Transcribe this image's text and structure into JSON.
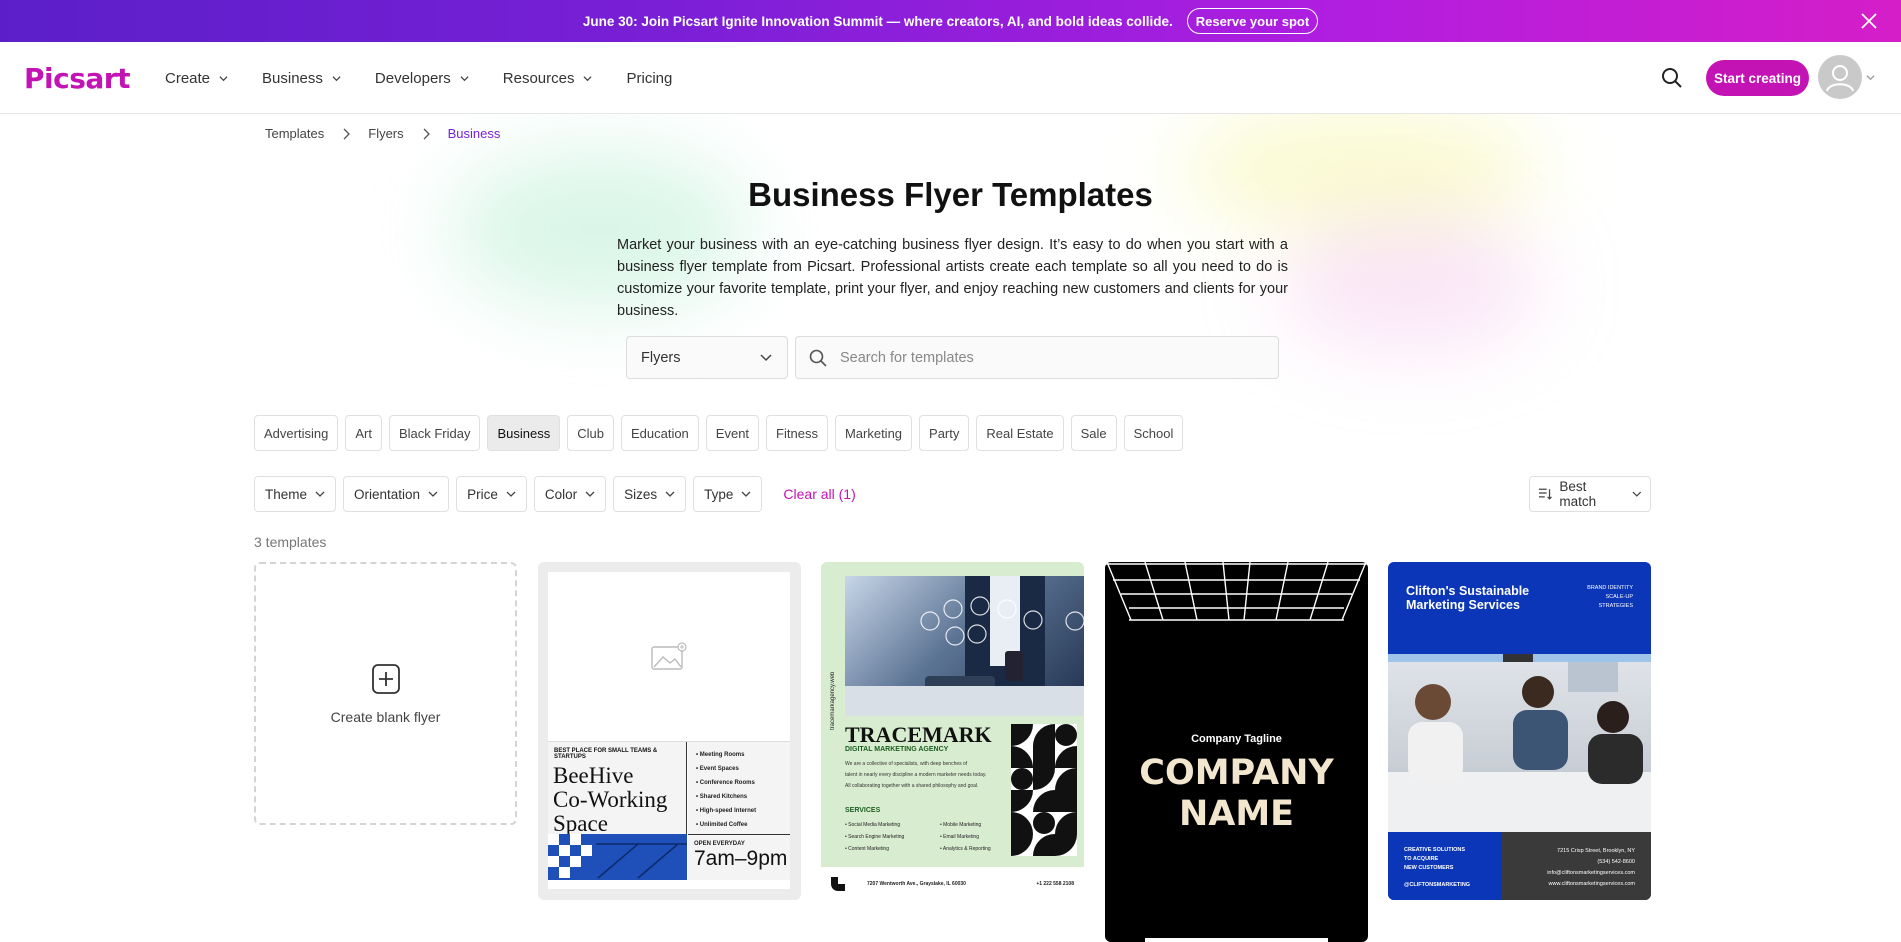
{
  "banner": {
    "text": "June 30: Join Picsart Ignite Innovation Summit — where creators, AI, and bold ideas collide.",
    "button": "Reserve your spot"
  },
  "header": {
    "logo": "Picsart",
    "nav": [
      {
        "label": "Create",
        "has_menu": true
      },
      {
        "label": "Business",
        "has_menu": true
      },
      {
        "label": "Developers",
        "has_menu": true
      },
      {
        "label": "Resources",
        "has_menu": true
      },
      {
        "label": "Pricing",
        "has_menu": false
      }
    ],
    "cta": "Start creating"
  },
  "breadcrumb": [
    "Templates",
    "Flyers",
    "Business"
  ],
  "page": {
    "title": "Business Flyer Templates",
    "intro": "Market your business with an eye-catching business flyer design. It’s easy to do when you start with a business flyer template from Picsart. Professional artists create each template so all you need to do is customize your favorite template, print your flyer, and enjoy reaching new customers and clients for your business."
  },
  "search": {
    "type_value": "Flyers",
    "placeholder": "Search for templates"
  },
  "chips": [
    {
      "label": "Advertising",
      "active": false
    },
    {
      "label": "Art",
      "active": false
    },
    {
      "label": "Black Friday",
      "active": false
    },
    {
      "label": "Business",
      "active": true
    },
    {
      "label": "Club",
      "active": false
    },
    {
      "label": "Education",
      "active": false
    },
    {
      "label": "Event",
      "active": false
    },
    {
      "label": "Fitness",
      "active": false
    },
    {
      "label": "Marketing",
      "active": false
    },
    {
      "label": "Party",
      "active": false
    },
    {
      "label": "Real Estate",
      "active": false
    },
    {
      "label": "Sale",
      "active": false
    },
    {
      "label": "School",
      "active": false
    }
  ],
  "filters": [
    "Theme",
    "Orientation",
    "Price",
    "Color",
    "Sizes",
    "Type"
  ],
  "clear_all": "Clear all (1)",
  "sort": "Best match",
  "results_count": "3 templates",
  "blank_card": {
    "label": "Create blank flyer"
  },
  "templates": {
    "beehive": {
      "tag": "BEST PLACE FOR SMALL TEAMS & STARTUPS",
      "title_lines": [
        "BeeHive",
        "Co-Working",
        "Space"
      ],
      "features": [
        "Meeting Rooms",
        "Event Spaces",
        "Conference Rooms",
        "Shared Kitchens",
        "High-speed Internet",
        "Unlimited Coffee"
      ],
      "open_label": "OPEN EVERYDAY",
      "hours": "7am–9pm"
    },
    "tracemark": {
      "side_url": "tracemarkagency.web",
      "name": "TRACEMARK",
      "subtitle": "DIGITAL MARKETING AGENCY",
      "about_lines": [
        "We are a collective of specialists, with deep benches of",
        "talent in nearly every discipline a modern marketer needs today.",
        "All collaborating together with a shared philosophy and goal."
      ],
      "services_label": "SERVICES",
      "services": [
        "Social Media Marketing",
        "Mobile Marketing",
        "Search Engine Marketing",
        "Email Marketing",
        "Content Marketing",
        "Analytics & Reporting"
      ],
      "address": "7207 Wentworth Ave., Grayslake, IL 60030",
      "phone": "+1 222 558 2108"
    },
    "company": {
      "tagline": "Company Tagline",
      "name_lines": [
        "COMPANY",
        "NAME"
      ]
    },
    "clifton": {
      "title_lines": [
        "Clifton's Sustainable",
        "Marketing Services"
      ],
      "side_lines": [
        "BRAND IDENTITY",
        "SCALE-UP",
        "STRATEGIES"
      ],
      "left_lines": [
        "CREATIVE SOLUTIONS",
        "TO ACQUIRE",
        "NEW CUSTOMERS"
      ],
      "handle": "@CLIFTONSMARKETING",
      "contact_lines": [
        "7215 Crisp Street, Brooklyn, NY",
        "(534) 542-8600",
        "info@cliftonsmarketingservices.com",
        "www.cliftonsmarketingservices.com"
      ]
    }
  }
}
